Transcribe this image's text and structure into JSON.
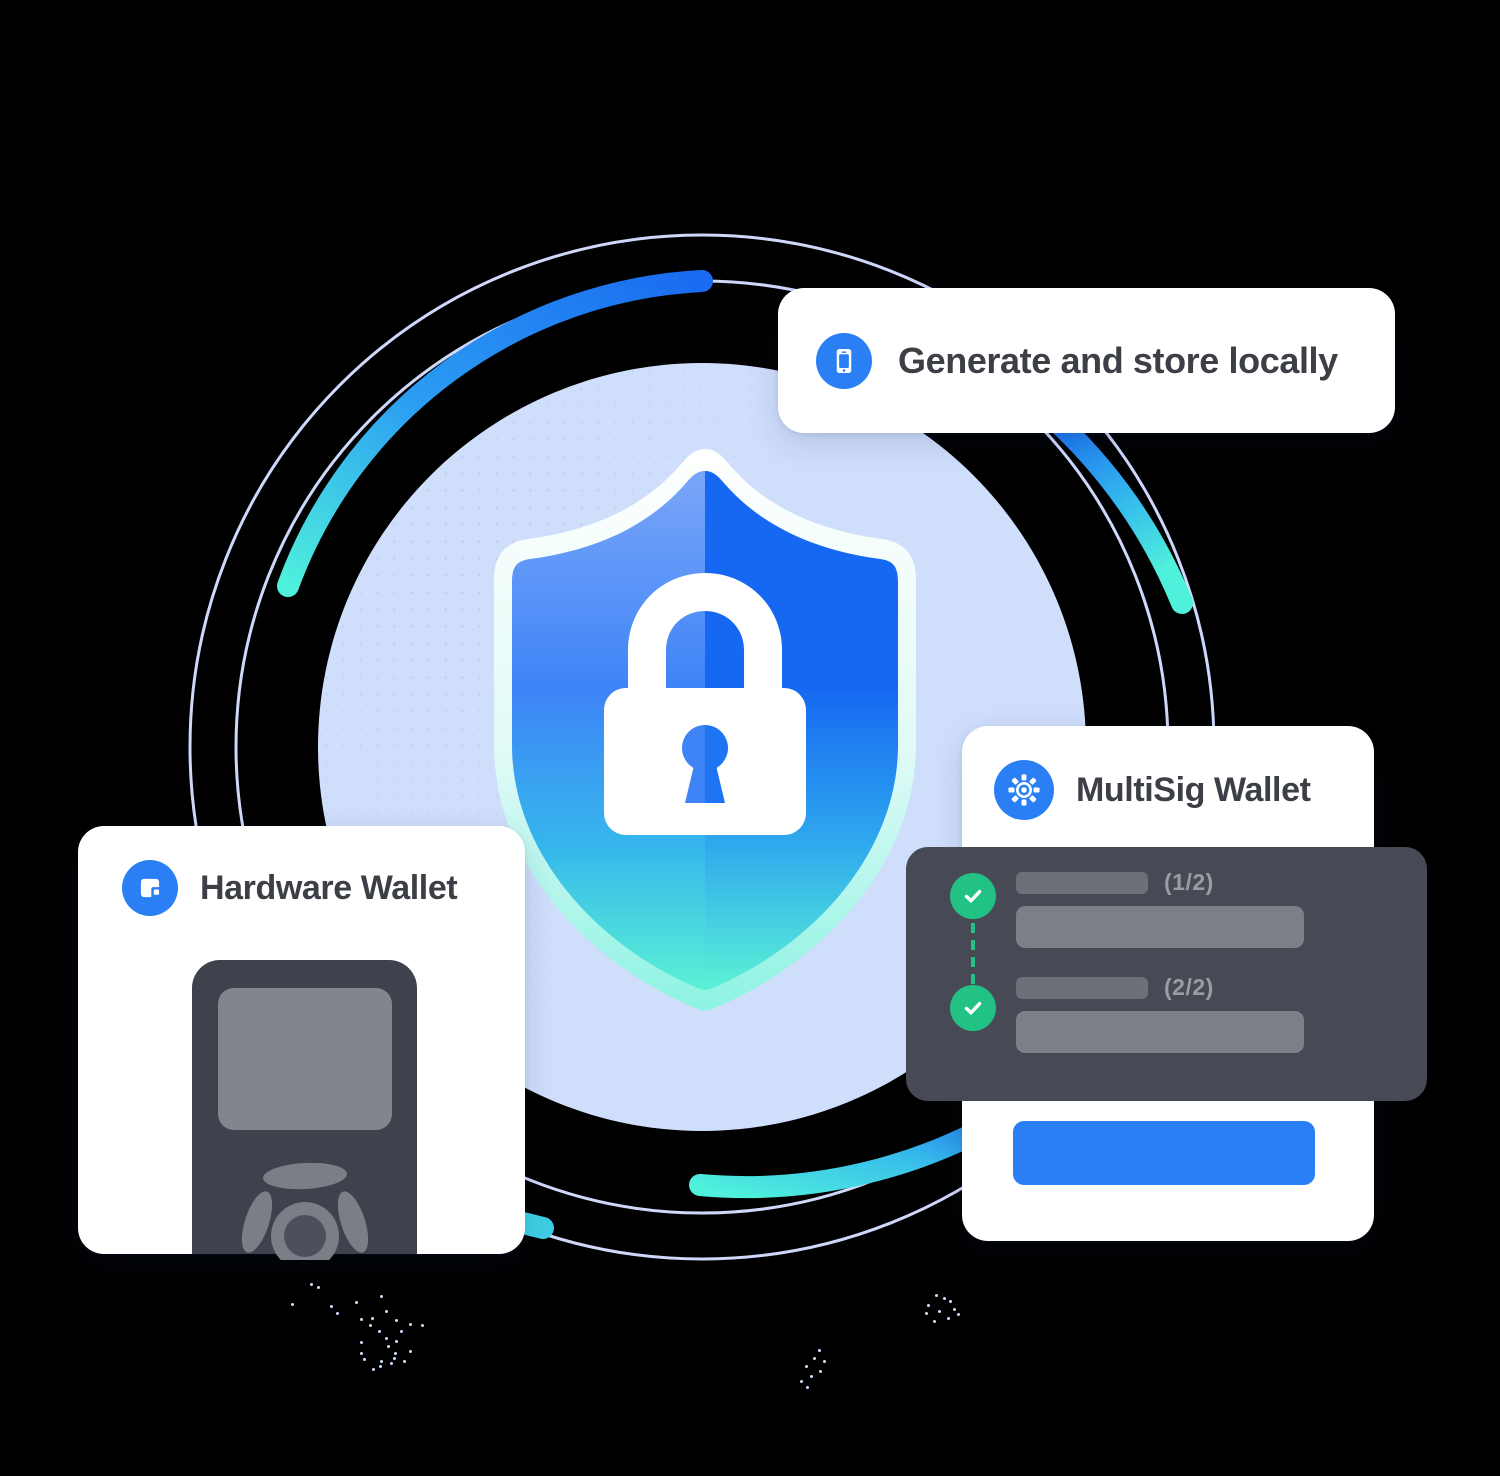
{
  "illustration": {
    "title": "Wallet security illustration",
    "center_icon": "shield-lock-icon",
    "colors": {
      "brand_blue": "#2b7ff5",
      "deep_blue": "#1a6bf0",
      "cyan": "#4ff0dc",
      "soft_circle": "#cfdefb",
      "dark_panel": "#474a55",
      "bar_gray": "#7d7f88",
      "bar_gray_dark": "#6d6f79",
      "check_green": "#22c285",
      "text_dark": "#3c3f46",
      "count_text": "#9a9ca4",
      "device_body": "#3f424d",
      "device_screen": "#83858d"
    }
  },
  "cards": {
    "generate": {
      "label": "Generate and store locally",
      "icon": "mobile-phone-icon"
    },
    "hardware": {
      "label": "Hardware Wallet",
      "icon": "hardware-device-icon",
      "device": "hardware-wallet-device"
    },
    "multisig": {
      "label": "MultiSig Wallet",
      "icon": "cog-ring-icon",
      "signatures": [
        {
          "count": "(1/2)",
          "status": "approved"
        },
        {
          "count": "(2/2)",
          "status": "approved"
        }
      ],
      "action_button": "confirm-button"
    }
  }
}
